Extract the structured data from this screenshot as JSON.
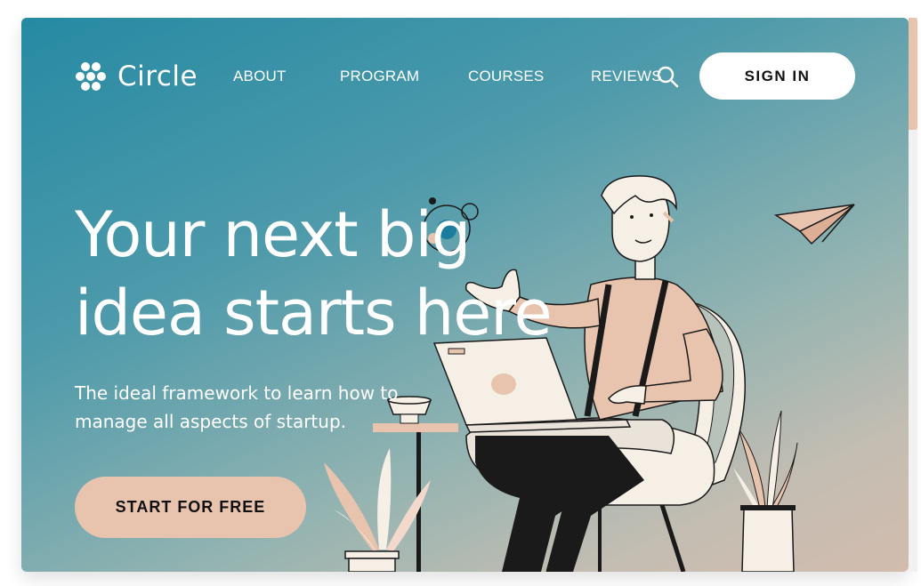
{
  "brand": {
    "name": "Circle"
  },
  "nav": {
    "items": [
      {
        "label": "ABOUT"
      },
      {
        "label": "PROGRAM"
      },
      {
        "label": "COURSES"
      },
      {
        "label": "REVIEWS"
      }
    ],
    "search_icon": "search-icon",
    "signin_label": "SIGN IN"
  },
  "hero": {
    "headline_line1": "Your next big",
    "headline_line2": "idea starts here",
    "subtitle": "The ideal framework to learn how to manage all aspects of startup.",
    "cta_label": "START FOR FREE"
  },
  "colors": {
    "gradient_start": "#268aa3",
    "gradient_end": "#d2bcae",
    "accent_peach": "#e8c3ae",
    "ink": "#1a1a1a",
    "cream": "#f6efe6"
  }
}
